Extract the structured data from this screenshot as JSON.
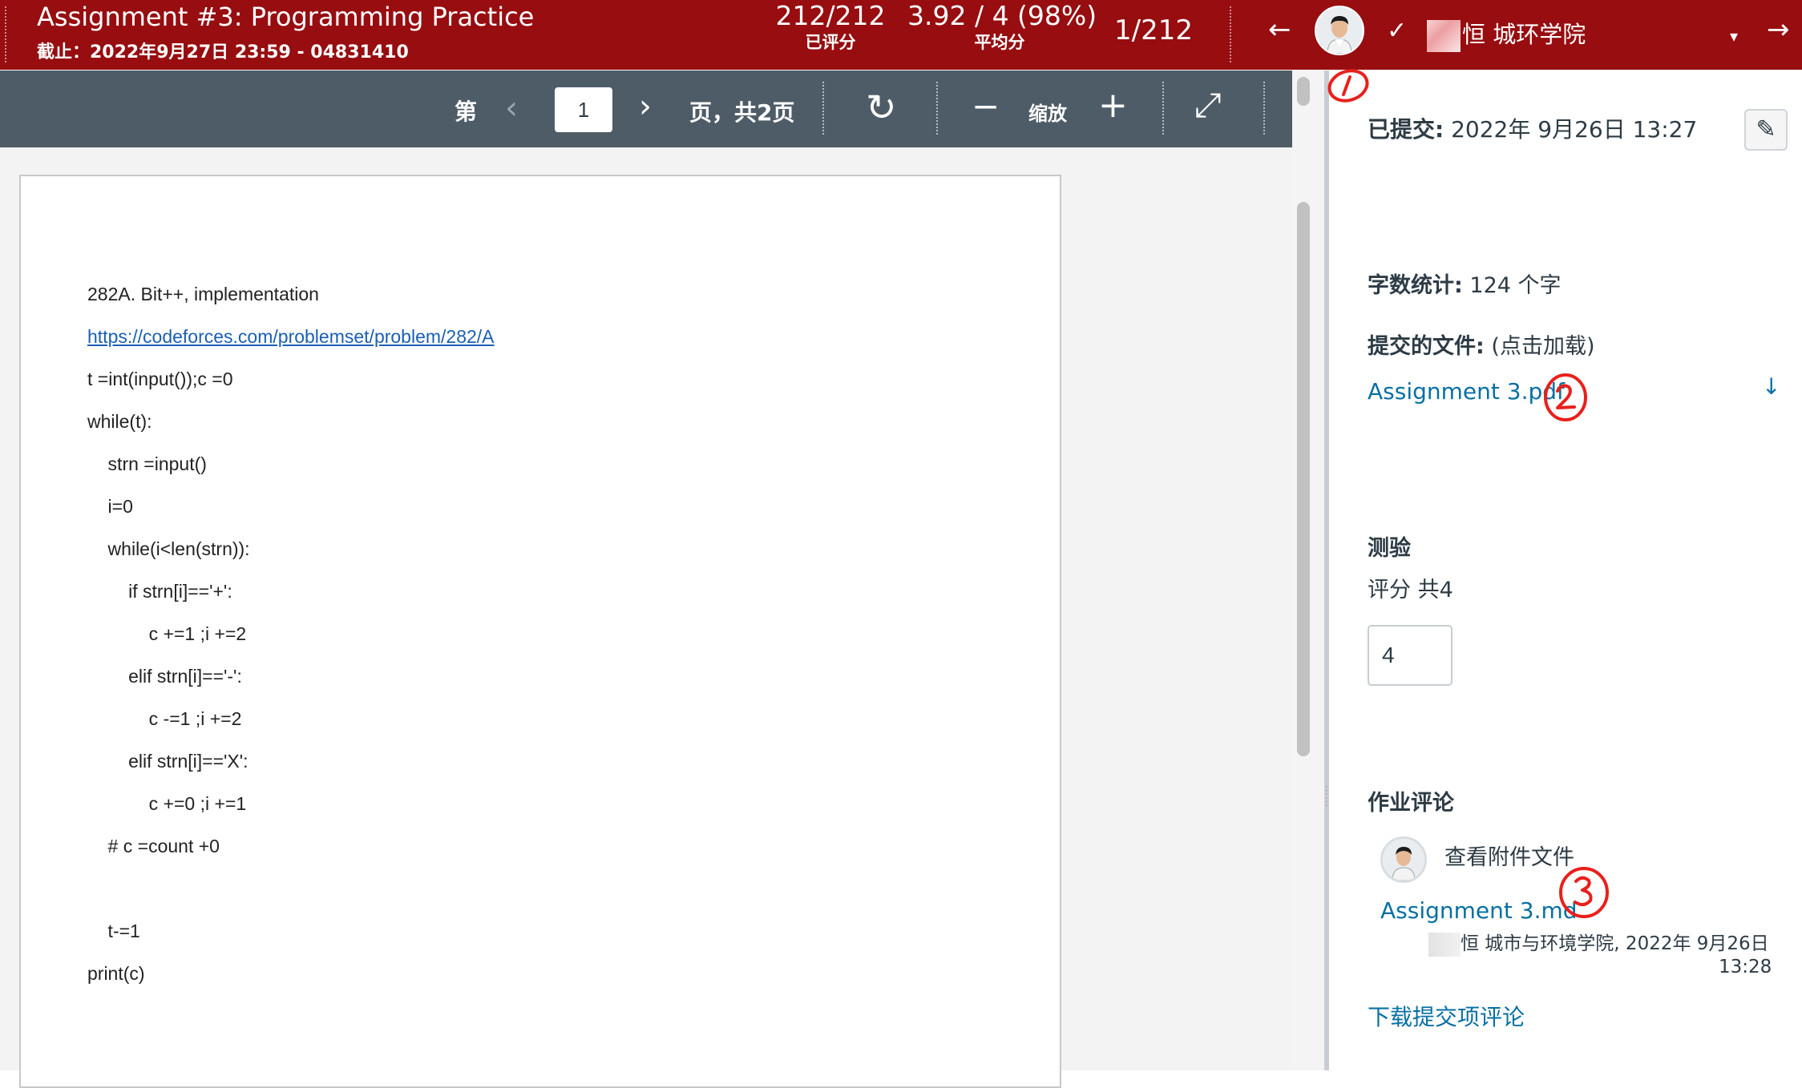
{
  "header": {
    "title": "Assignment #3: Programming Practice",
    "due": "截止：2022年9月27日 23:59 - 04831410",
    "graded_value": "212/212",
    "graded_label": "已评分",
    "average_value": "3.92 / 4 (98%)",
    "average_label": "平均分",
    "position": "1/212",
    "prev_icon": "←",
    "next_icon": "→",
    "check_icon": "✓",
    "dropdown_icon": "▾",
    "student_name": "恒 城环学院"
  },
  "toolbar": {
    "page_prefix": "第",
    "current_page": "1",
    "page_suffix": "页，共2页",
    "zoom_label": "缩放",
    "prev_icon": "‹",
    "next_icon": "›",
    "rotate_icon": "↻",
    "zoom_out_icon": "−",
    "zoom_in_icon": "+",
    "fullscreen_icon": "⤢"
  },
  "document": {
    "lines": [
      "282A. Bit++, implementation",
      "https://codeforces.com/problemset/problem/282/A",
      "t =int(input());c =0",
      "while(t):",
      "    strn =input()",
      "    i=0",
      "    while(i<len(strn)):",
      "        if strn[i]=='+':",
      "            c +=1 ;i +=2",
      "        elif strn[i]=='-':",
      "            c -=1 ;i +=2",
      "        elif strn[i]=='X':",
      "            c +=0 ;i +=1",
      "    # c =count +0",
      "",
      "    t-=1",
      "print(c)"
    ]
  },
  "sidebar": {
    "submitted_label": "已提交:",
    "submitted_date": "2022年 9月26日 13:27",
    "edit_icon": "✎",
    "wordcount_label": "字数统计:",
    "wordcount_value": "124 个字",
    "files_label": "提交的文件:",
    "files_hint": "(点击加载)",
    "file_name": "Assignment 3.pdf",
    "download_icon": "↓",
    "quiz_title": "测验",
    "score_label": "评分 共4",
    "score_value": "4",
    "comments_title": "作业评论",
    "comment_text": "查看附件文件",
    "comment_file": "Assignment 3.md",
    "comment_meta": "恒 城市与环境学院, 2022年 9月26日",
    "comment_time": "13:28",
    "download_comments": "下载提交项评论"
  },
  "annotations": [
    "1",
    "2",
    "3"
  ],
  "colors": {
    "header_bg": "#970d10",
    "toolbar_bg": "#4e5c68",
    "link": "#0770a3",
    "annotation": "#e8201c"
  }
}
